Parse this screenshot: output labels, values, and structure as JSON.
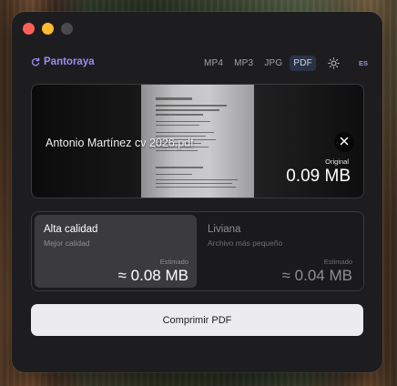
{
  "app": {
    "name": "Pantoraya"
  },
  "formats": [
    {
      "label": "MP4",
      "active": false
    },
    {
      "label": "MP3",
      "active": false
    },
    {
      "label": "JPG",
      "active": false
    },
    {
      "label": "PDF",
      "active": true
    }
  ],
  "theme_icon": "sun-icon",
  "language": "ES",
  "file": {
    "name": "Antonio Martínez cv 2026.pdf",
    "original_label": "Original",
    "original_size": "0.09 MB"
  },
  "options": [
    {
      "title": "Alta calidad",
      "subtitle": "Mejor calidad",
      "estimate_label": "Estimado",
      "estimate": "≈ 0.08 MB",
      "selected": true
    },
    {
      "title": "Liviana",
      "subtitle": "Archivo más pequeño",
      "estimate_label": "Estimado",
      "estimate": "≈ 0.04 MB",
      "selected": false
    }
  ],
  "action": {
    "label": "Comprimir PDF"
  },
  "colors": {
    "brand": "#9a8df2",
    "accent_active": "#2a3346",
    "button_bg": "#ececee"
  }
}
